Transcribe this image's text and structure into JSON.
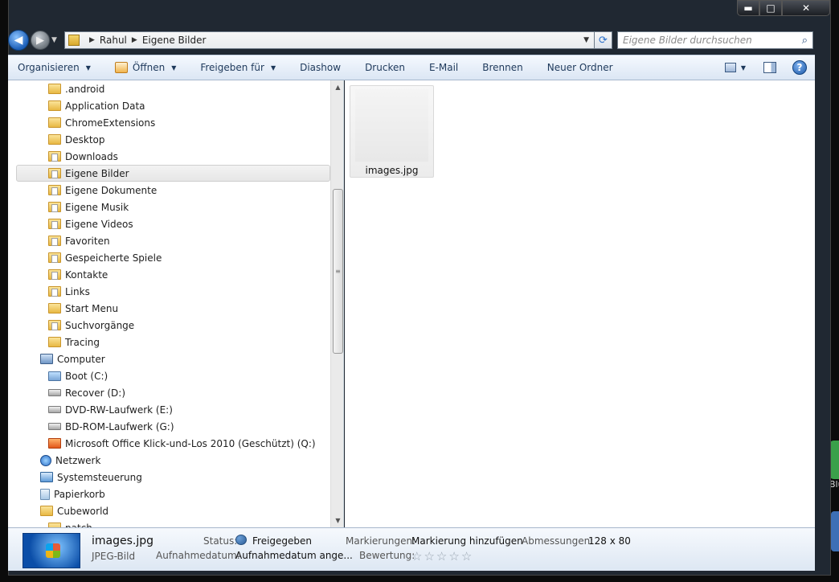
{
  "window": {
    "minimize": "▬",
    "maximize": "□",
    "close": "✕"
  },
  "nav": {
    "back": "◀",
    "forward": "▶",
    "path": [
      "Rahul",
      "Eigene Bilder"
    ],
    "search_placeholder": "Eigene Bilder durchsuchen"
  },
  "toolbar": {
    "organize": "Organisieren",
    "open": "Öffnen",
    "share": "Freigeben für",
    "slideshow": "Diashow",
    "print": "Drucken",
    "email": "E-Mail",
    "burn": "Brennen",
    "new_folder": "Neuer Ordner"
  },
  "tree": [
    {
      "label": ".android",
      "icon": "folder-icon"
    },
    {
      "label": "Application Data",
      "icon": "folder-icon"
    },
    {
      "label": "ChromeExtensions",
      "icon": "folder-icon"
    },
    {
      "label": "Desktop",
      "icon": "folder-icon"
    },
    {
      "label": "Downloads",
      "icon": "downloads-folder-icon"
    },
    {
      "label": "Eigene Bilder",
      "icon": "pictures-folder-icon",
      "selected": true
    },
    {
      "label": "Eigene Dokumente",
      "icon": "documents-folder-icon"
    },
    {
      "label": "Eigene Musik",
      "icon": "music-folder-icon"
    },
    {
      "label": "Eigene Videos",
      "icon": "videos-folder-icon"
    },
    {
      "label": "Favoriten",
      "icon": "favorites-folder-icon"
    },
    {
      "label": "Gespeicherte Spiele",
      "icon": "saved-games-folder-icon"
    },
    {
      "label": "Kontakte",
      "icon": "contacts-folder-icon"
    },
    {
      "label": "Links",
      "icon": "links-folder-icon"
    },
    {
      "label": "Start Menu",
      "icon": "folder-icon"
    },
    {
      "label": "Suchvorgänge",
      "icon": "searches-folder-icon"
    },
    {
      "label": "Tracing",
      "icon": "folder-icon"
    },
    {
      "label": "Computer",
      "icon": "computer-icon",
      "level": 0
    },
    {
      "label": "Boot (C:)",
      "icon": "system-drive-icon"
    },
    {
      "label": "Recover (D:)",
      "icon": "drive-icon"
    },
    {
      "label": "DVD-RW-Laufwerk (E:)",
      "icon": "dvd-drive-icon"
    },
    {
      "label": "BD-ROM-Laufwerk (G:)",
      "icon": "bd-drive-icon"
    },
    {
      "label": "Microsoft Office Klick-und-Los 2010 (Geschützt) (Q:)",
      "icon": "office-drive-icon"
    },
    {
      "label": "Netzwerk",
      "icon": "network-icon",
      "level": 0
    },
    {
      "label": "Systemsteuerung",
      "icon": "control-panel-icon",
      "level": 0
    },
    {
      "label": "Papierkorb",
      "icon": "recycle-bin-icon",
      "level": 0
    },
    {
      "label": "Cubeworld",
      "icon": "folder-icon",
      "level": 0
    },
    {
      "label": "patch",
      "icon": "folder-icon"
    }
  ],
  "files": [
    {
      "name": "images.jpg"
    }
  ],
  "details": {
    "name": "images.jpg",
    "type": "JPEG-Bild",
    "status_label": "Status:",
    "status_value": "Freigegeben",
    "date_label": "Aufnahmedatum:",
    "date_value": "Aufnahmedatum ange...",
    "tags_label": "Markierungen:",
    "tags_value": "Markierung hinzufügen",
    "rating_label": "Bewertung:",
    "dims_label": "Abmessungen:",
    "dims_value": "128 x 80",
    "rating_stars": 0
  },
  "desktop": {
    "right_label": "Blu"
  }
}
